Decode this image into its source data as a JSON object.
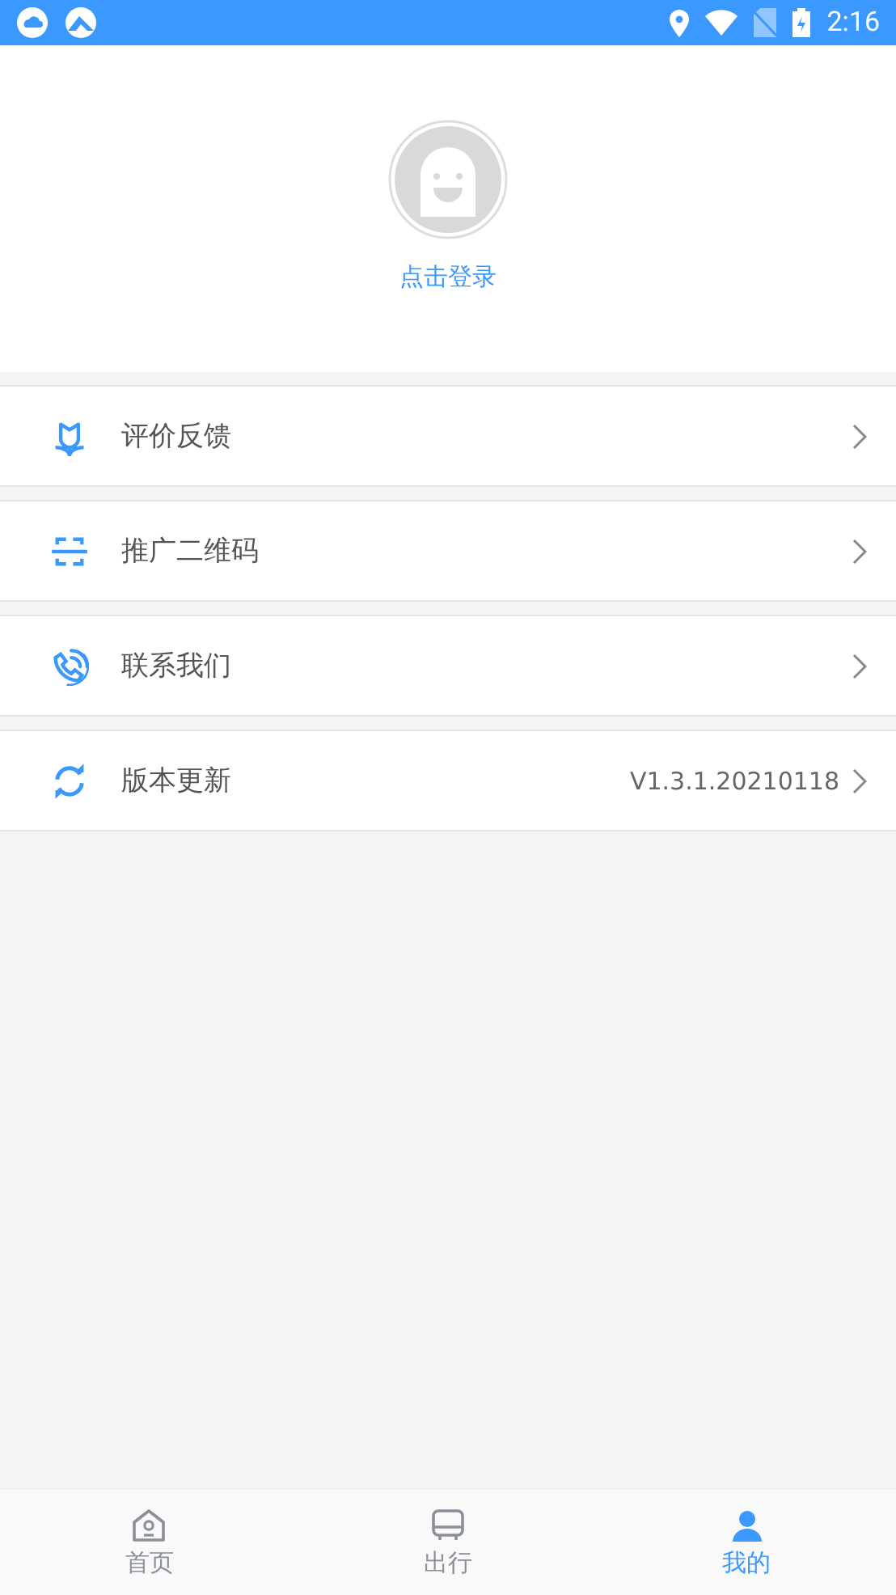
{
  "status_bar": {
    "time": "2:16"
  },
  "profile": {
    "login_label": "点击登录"
  },
  "menu": [
    {
      "kind": "feedback",
      "label": "评价反馈"
    },
    {
      "kind": "qrcode",
      "label": "推广二维码"
    },
    {
      "kind": "contact",
      "label": "联系我们"
    },
    {
      "kind": "update",
      "label": "版本更新",
      "value": "V1.3.1.20210118"
    }
  ],
  "tabs": [
    {
      "kind": "home",
      "label": "首页",
      "selected": false
    },
    {
      "kind": "bus",
      "label": "出行",
      "selected": false
    },
    {
      "kind": "person",
      "label": "我的",
      "selected": true
    }
  ]
}
